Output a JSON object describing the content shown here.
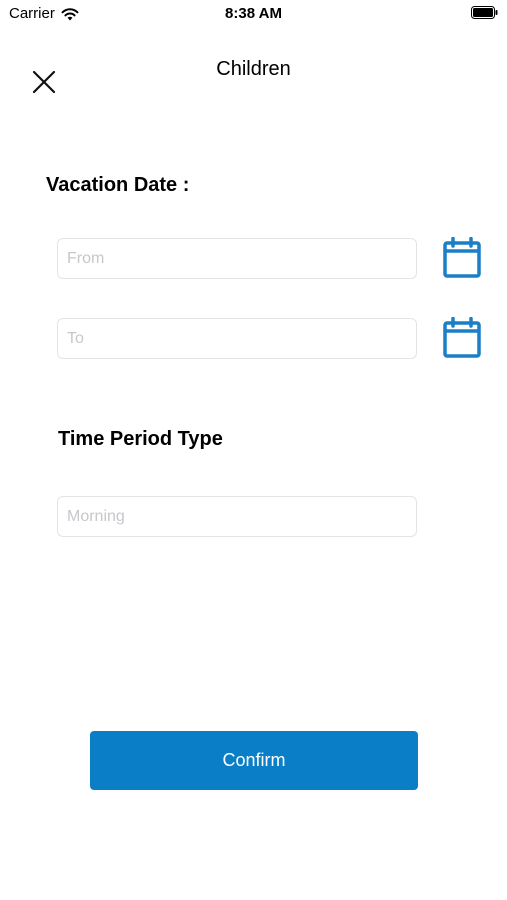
{
  "status_bar": {
    "carrier": "Carrier",
    "time": "8:38 AM",
    "wifi_icon": "wifi-icon",
    "battery_icon": "battery-icon"
  },
  "nav": {
    "title": "Children",
    "close_icon": "close-icon"
  },
  "vacation": {
    "heading": "Vacation Date :",
    "from_placeholder": "From",
    "to_placeholder": "To",
    "calendar_icon": "calendar-icon"
  },
  "period": {
    "heading": "Time Period Type",
    "placeholder": "Morning"
  },
  "confirm": {
    "label": "Confirm"
  },
  "colors": {
    "accent": "#0a7fc7",
    "icon_blue": "#1a7fc4",
    "field_border": "#e4e4e4",
    "placeholder": "#c7c7cc"
  }
}
